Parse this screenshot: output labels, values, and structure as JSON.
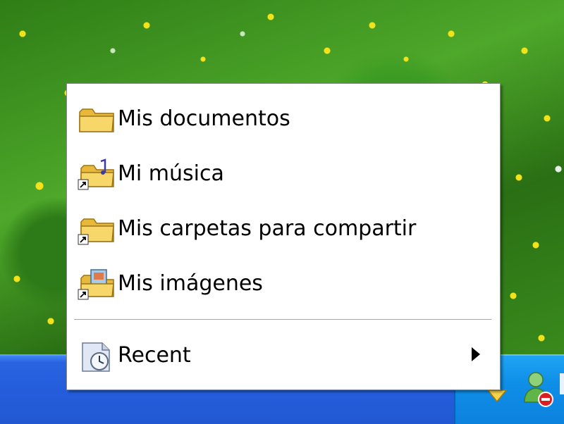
{
  "menu": {
    "items": [
      {
        "label": "Mis documentos",
        "icon": "folder-icon",
        "shortcut": false
      },
      {
        "label": "Mi música",
        "icon": "music-folder-icon",
        "shortcut": true
      },
      {
        "label": "Mis carpetas para compartir",
        "icon": "shared-folder-icon",
        "shortcut": true
      },
      {
        "label": "Mis imágenes",
        "icon": "pictures-folder-icon",
        "shortcut": true
      }
    ],
    "recent": {
      "label": "Recent",
      "icon": "recent-documents-icon",
      "has_submenu": true
    }
  },
  "colors": {
    "taskbar": "#245ddb",
    "tray": "#0f8fe8",
    "menu_background": "#ffffff",
    "folder_yellow": "#f2c84b"
  },
  "tray": {
    "icons": [
      "show-hidden-icons-arrow-icon",
      "user-status-offline-icon"
    ]
  }
}
